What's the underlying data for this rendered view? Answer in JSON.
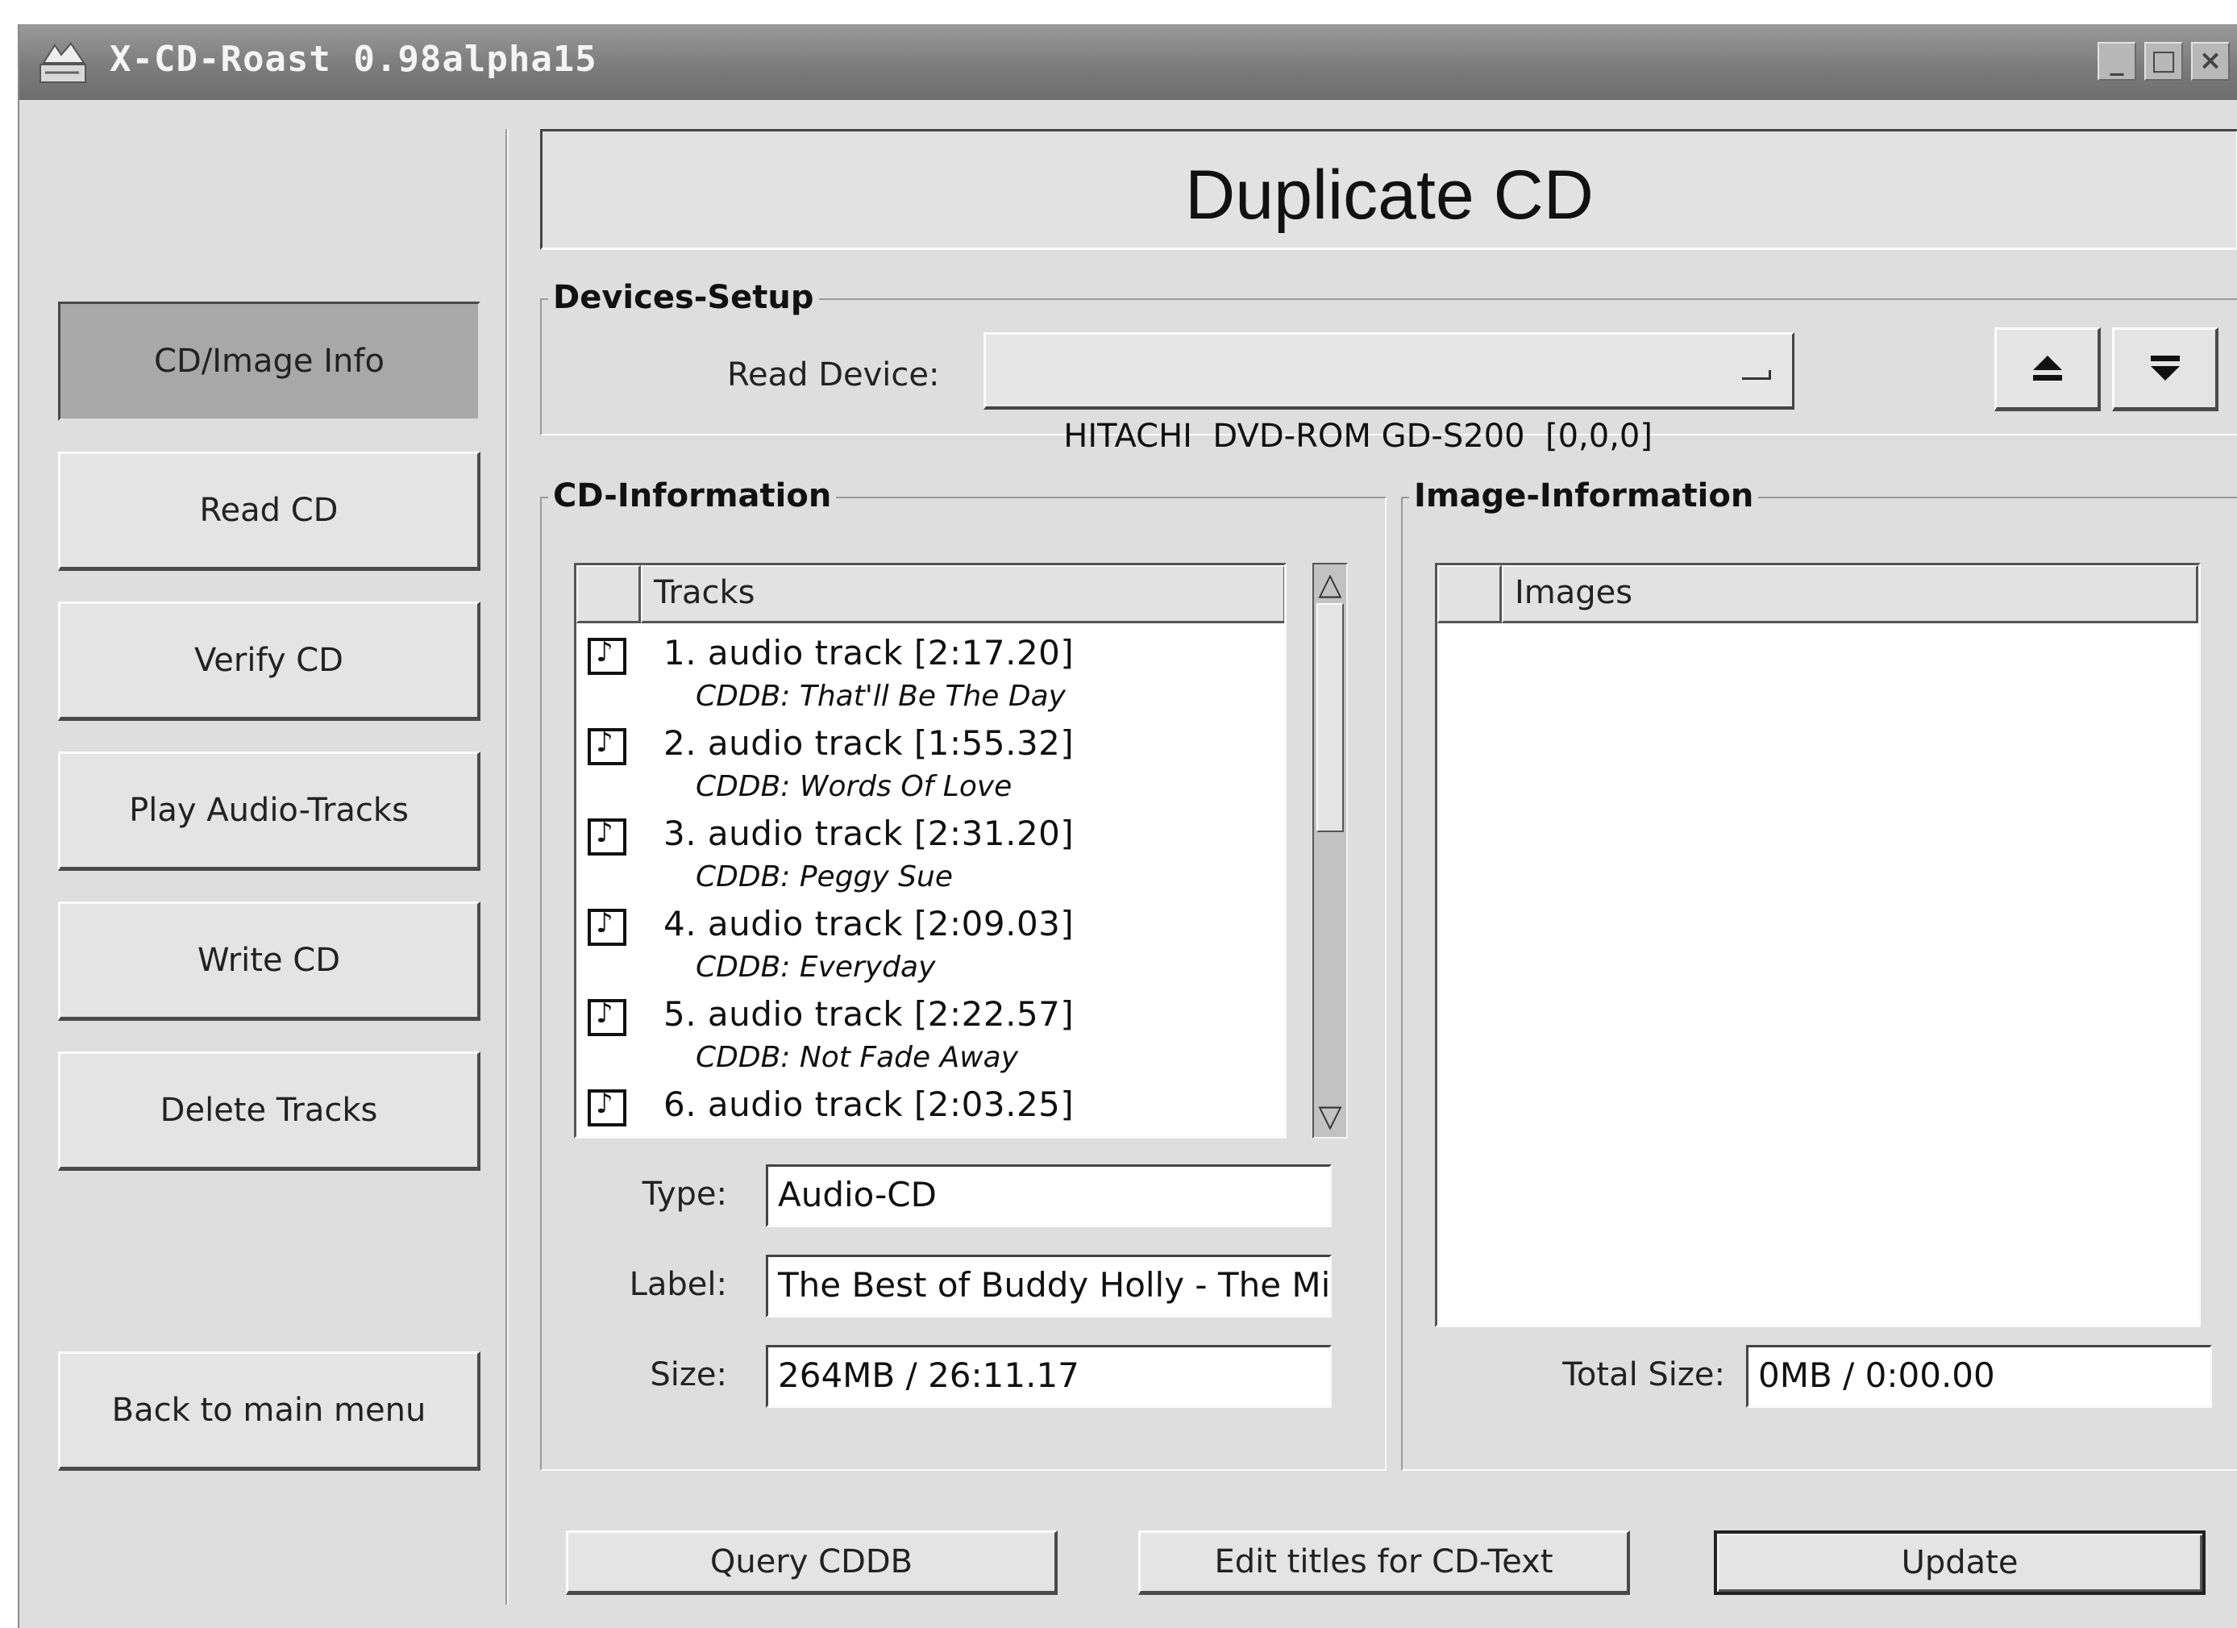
{
  "window": {
    "title": "X-CD-Roast 0.98alpha15",
    "controls": {
      "minimize": "_",
      "maximize": "□",
      "close": "×"
    }
  },
  "sidebar": {
    "items": [
      {
        "label": "CD/Image Info",
        "active": true
      },
      {
        "label": "Read CD",
        "active": false
      },
      {
        "label": "Verify CD",
        "active": false
      },
      {
        "label": "Play Audio-Tracks",
        "active": false
      },
      {
        "label": "Write CD",
        "active": false
      },
      {
        "label": "Delete Tracks",
        "active": false
      }
    ],
    "back_label": "Back to main menu"
  },
  "header": {
    "title": "Duplicate CD"
  },
  "devices_setup": {
    "group_label": "Devices-Setup",
    "read_device_label": "Read Device:",
    "read_device_value": "HITACHI  DVD-ROM GD-S200  [0,0,0]",
    "eject_icon": "eject-icon",
    "load_icon": "load-tray-icon"
  },
  "cd_information": {
    "group_label": "CD-Information",
    "tracks_header": "Tracks",
    "tracks": [
      {
        "title": "1. audio track [2:17.20]",
        "cddb": "CDDB: That'll Be The Day"
      },
      {
        "title": "2. audio track [1:55.32]",
        "cddb": "CDDB: Words Of Love"
      },
      {
        "title": "3. audio track [2:31.20]",
        "cddb": "CDDB: Peggy Sue"
      },
      {
        "title": "4. audio track [2:09.03]",
        "cddb": "CDDB: Everyday"
      },
      {
        "title": "5. audio track [2:22.57]",
        "cddb": "CDDB: Not Fade Away"
      },
      {
        "title": "6. audio track [2:03.25]",
        "cddb": ""
      }
    ],
    "type_label": "Type:",
    "type_value": "Audio-CD",
    "label_label": "Label:",
    "label_value": "The Best of Buddy Holly - The Mill",
    "size_label": "Size:",
    "size_value": "264MB / 26:11.17"
  },
  "image_information": {
    "group_label": "Image-Information",
    "images_header": "Images",
    "total_size_label": "Total Size:",
    "total_size_value": "0MB / 0:00.00"
  },
  "actions": {
    "query_cddb": "Query CDDB",
    "edit_titles": "Edit titles for CD-Text",
    "update": "Update"
  }
}
